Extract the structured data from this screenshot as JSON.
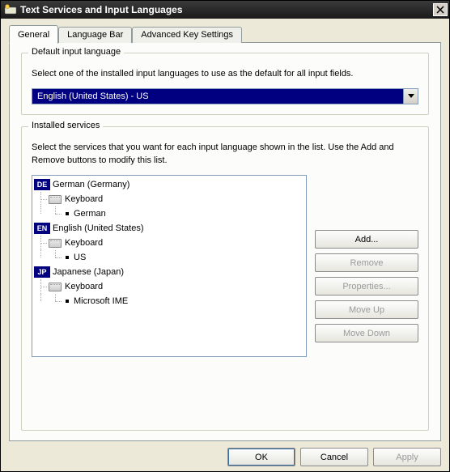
{
  "window": {
    "title": "Text Services and Input Languages",
    "icon_name": "keyboard-regional-icon"
  },
  "tabs": [
    {
      "label": "General",
      "active": true
    },
    {
      "label": "Language Bar",
      "active": false
    },
    {
      "label": "Advanced Key Settings",
      "active": false
    }
  ],
  "default_lang": {
    "group_title": "Default input language",
    "help_text": "Select one of the installed input languages to use as the default for all input fields.",
    "selected": "English (United States) - US"
  },
  "services": {
    "group_title": "Installed services",
    "help_text": "Select the services that you want for each input language shown in the list. Use the Add and Remove buttons to modify this list.",
    "tree": [
      {
        "badge": "DE",
        "name": "German (Germany)",
        "category": "Keyboard",
        "layouts": [
          "German"
        ]
      },
      {
        "badge": "EN",
        "name": "English (United States)",
        "category": "Keyboard",
        "layouts": [
          "US"
        ]
      },
      {
        "badge": "JP",
        "name": "Japanese (Japan)",
        "category": "Keyboard",
        "layouts": [
          "Microsoft IME"
        ]
      }
    ],
    "buttons": {
      "add": "Add...",
      "remove": "Remove",
      "properties": "Properties...",
      "move_up": "Move Up",
      "move_down": "Move Down"
    }
  },
  "dialog_buttons": {
    "ok": "OK",
    "cancel": "Cancel",
    "apply": "Apply"
  }
}
